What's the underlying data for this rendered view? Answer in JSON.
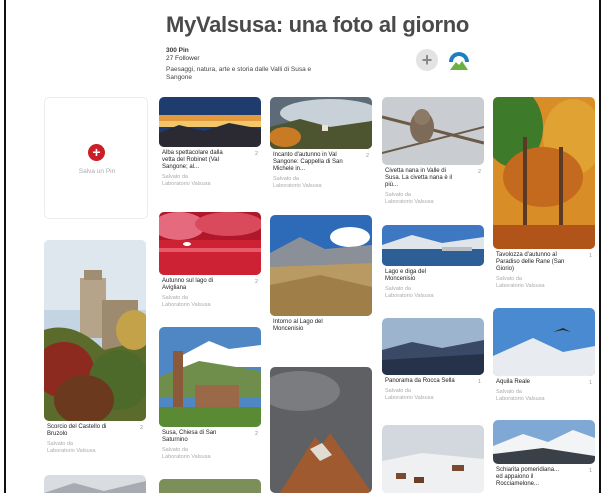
{
  "board": {
    "title": "MyValsusa: una foto al giorno",
    "pins_count": "300 Pin",
    "followers_count": "27 Follower",
    "description": "Paesaggi, natura, arte e storia dalle Valli di Susa e Sangone"
  },
  "save_pin_label": "Salva un Pin",
  "saved_from_label": "Salvato da",
  "pins": [
    {
      "title": "Alba spettacolare dalla vetta del Robinet (Val Sangone; al...",
      "count": "2",
      "source": "Laboratorio Valsusa"
    },
    {
      "title": "Incanto d'autunno in Val Sangone: Cappella di San Michele in...",
      "count": "2",
      "source": "Laboratorio Valsusa"
    },
    {
      "title": "Civetta nana in Valle di Susa. La civetta nana è il più...",
      "count": "2",
      "source": "Laboratorio Valsusa"
    },
    {
      "title": "Tavolozza d'autunno al Paradiso delle Rane (San Giorio)",
      "count": "1",
      "source": "Laboratorio Valsusa"
    },
    {
      "title": "Autunno sul lago di Avigliana",
      "count": "2",
      "source": "Laboratorio Valsusa"
    },
    {
      "title": "Intorno al Lago del Moncenisio",
      "count": "",
      "source": ""
    },
    {
      "title": "Lago e diga del Moncenisio",
      "count": "",
      "source": "Laboratorio Valsusa"
    },
    {
      "title": "Scorcio del Castello di Bruzolo",
      "count": "2",
      "source": "Laboratorio Valsusa"
    },
    {
      "title": "Susa, Chiesa di San Saturnino",
      "count": "2",
      "source": "Laboratorio Valsusa"
    },
    {
      "title": "Panorama da Rocca Sella",
      "count": "1",
      "source": "Laboratorio Valsusa"
    },
    {
      "title": "Aquila Reale",
      "count": "1",
      "source": "Laboratorio Valsusa"
    },
    {
      "title": "Schiarita pomeridiana... ed appaiono il Rocciamelone...",
      "count": "1",
      "source": ""
    }
  ]
}
